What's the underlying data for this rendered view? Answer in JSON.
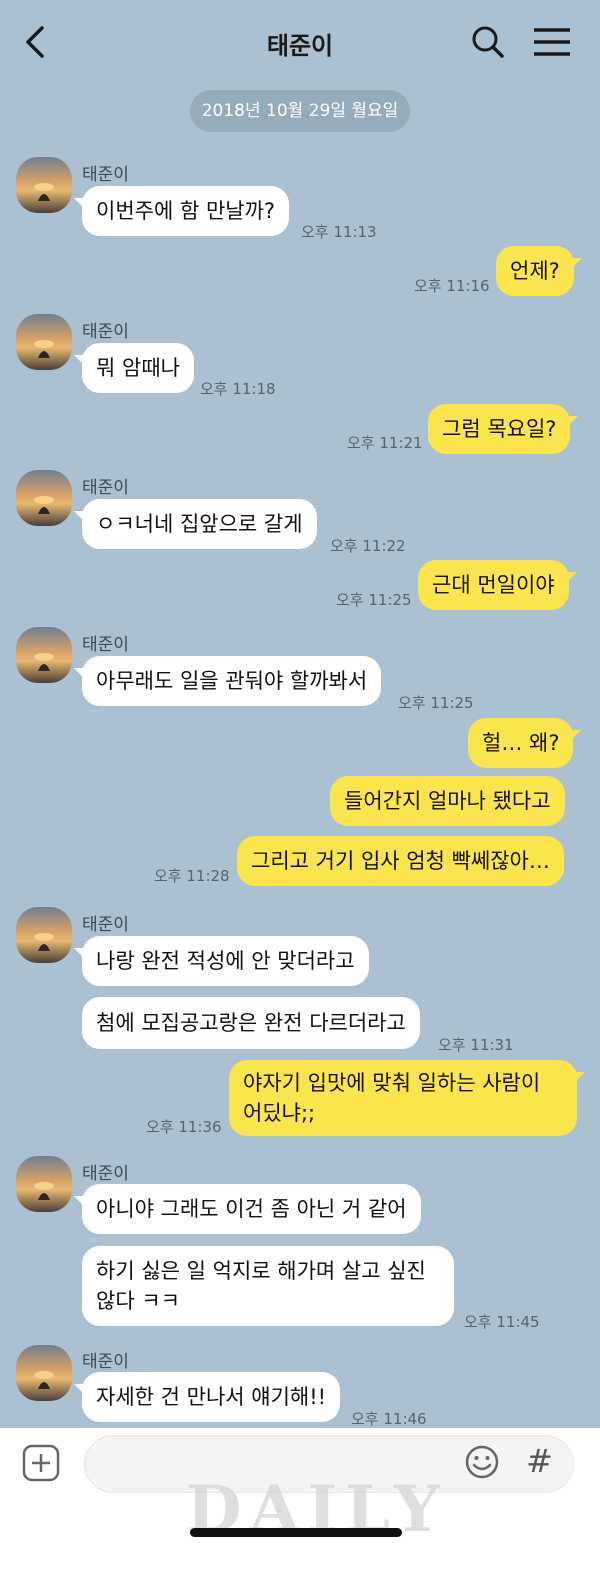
{
  "header": {
    "title": "태준이"
  },
  "date_divider": "2018년 10월 29일 월요일",
  "contact_name": "태준이",
  "messages": [
    {
      "text": "이번주에 함 만날까?",
      "time": "오후 11:13"
    },
    {
      "text": "언제?",
      "time": "오후 11:16"
    },
    {
      "text": "뭐 암때나",
      "time": "오후 11:18"
    },
    {
      "text": "그럼 목요일?",
      "time": "오후 11:21"
    },
    {
      "text": "ㅇㅋ너네 집앞으로 갈게",
      "time": "오후 11:22"
    },
    {
      "text": "근대 먼일이야",
      "time": "오후 11:25"
    },
    {
      "text": "아무래도 일을 관둬야 할까봐서",
      "time": "오후 11:25"
    },
    {
      "text": "헐… 왜?"
    },
    {
      "text": "들어간지 얼마나 됐다고"
    },
    {
      "text": "그리고 거기 입사 엄청 빡쎄잖아…",
      "time": "오후 11:28"
    },
    {
      "text": "나랑 완전 적성에 안 맞더라고"
    },
    {
      "text": "첨에 모집공고랑은 완전 다르더라고",
      "time": "오후 11:31"
    },
    {
      "text": "야자기 입맛에 맞춰 일하는 사람이 어딨냐;;",
      "time": "오후 11:36"
    },
    {
      "text": "아니야 그래도 이건 좀 아닌 거 같어"
    },
    {
      "text": "하기 싫은 일 억지로 해가며 살고 싶진 않다 ㅋㅋ",
      "time": "오후 11:45"
    },
    {
      "text": "자세한 건 만나서 얘기해!!",
      "time": "오후 11:46"
    }
  ],
  "composer": {
    "placeholder": "",
    "watermark": "DAILY"
  }
}
